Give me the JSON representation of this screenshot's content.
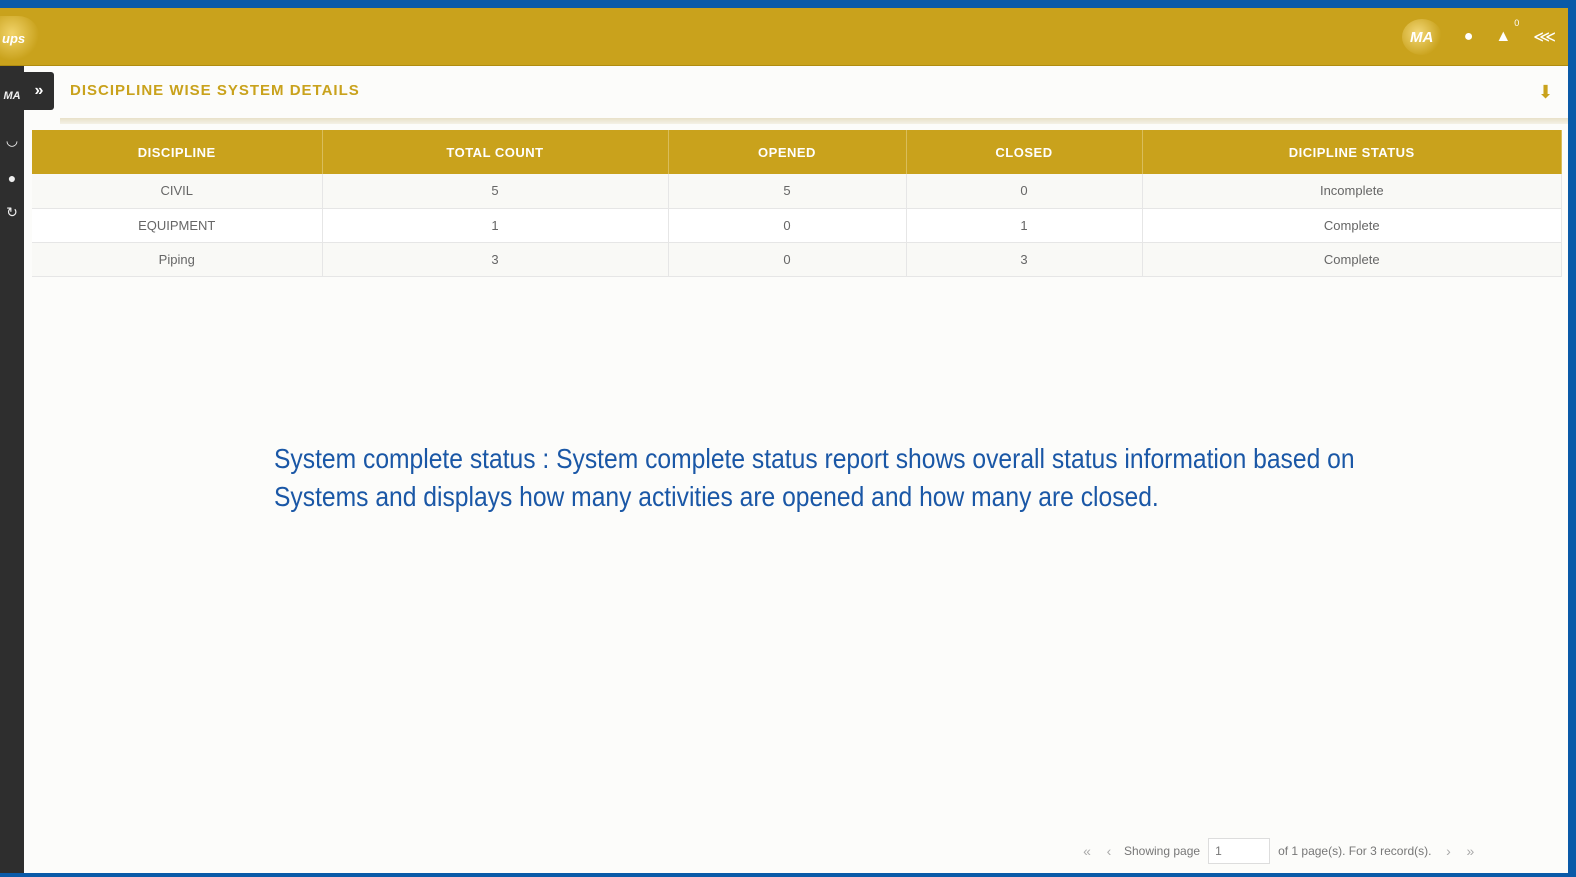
{
  "header": {
    "logo_text": "ups",
    "user_badge": "MA",
    "notification_count": "0"
  },
  "sidebar": {
    "badge": "MA",
    "collapse_label": "»"
  },
  "panel": {
    "title": "DISCIPLINE WISE SYSTEM DETAILS"
  },
  "table": {
    "columns": [
      "DISCIPLINE",
      "TOTAL COUNT",
      "OPENED",
      "CLOSED",
      "DICIPLINE STATUS"
    ],
    "rows": [
      [
        "CIVIL",
        "5",
        "5",
        "0",
        "Incomplete"
      ],
      [
        "EQUIPMENT",
        "1",
        "0",
        "1",
        "Complete"
      ],
      [
        "Piping",
        "3",
        "0",
        "3",
        "Complete"
      ]
    ]
  },
  "caption": "System complete status : System complete status report shows overall status information based on Systems and displays how many activities are opened and how many are closed.",
  "pager": {
    "showing_label": "Showing page",
    "page_value": "1",
    "summary": "of 1 page(s). For 3 record(s)."
  },
  "colors": {
    "accent_gold": "#c9a21c",
    "frame_blue": "#0a5aa8",
    "caption_blue": "#1a57a6",
    "sidebar_dark": "#2e2e2e"
  }
}
